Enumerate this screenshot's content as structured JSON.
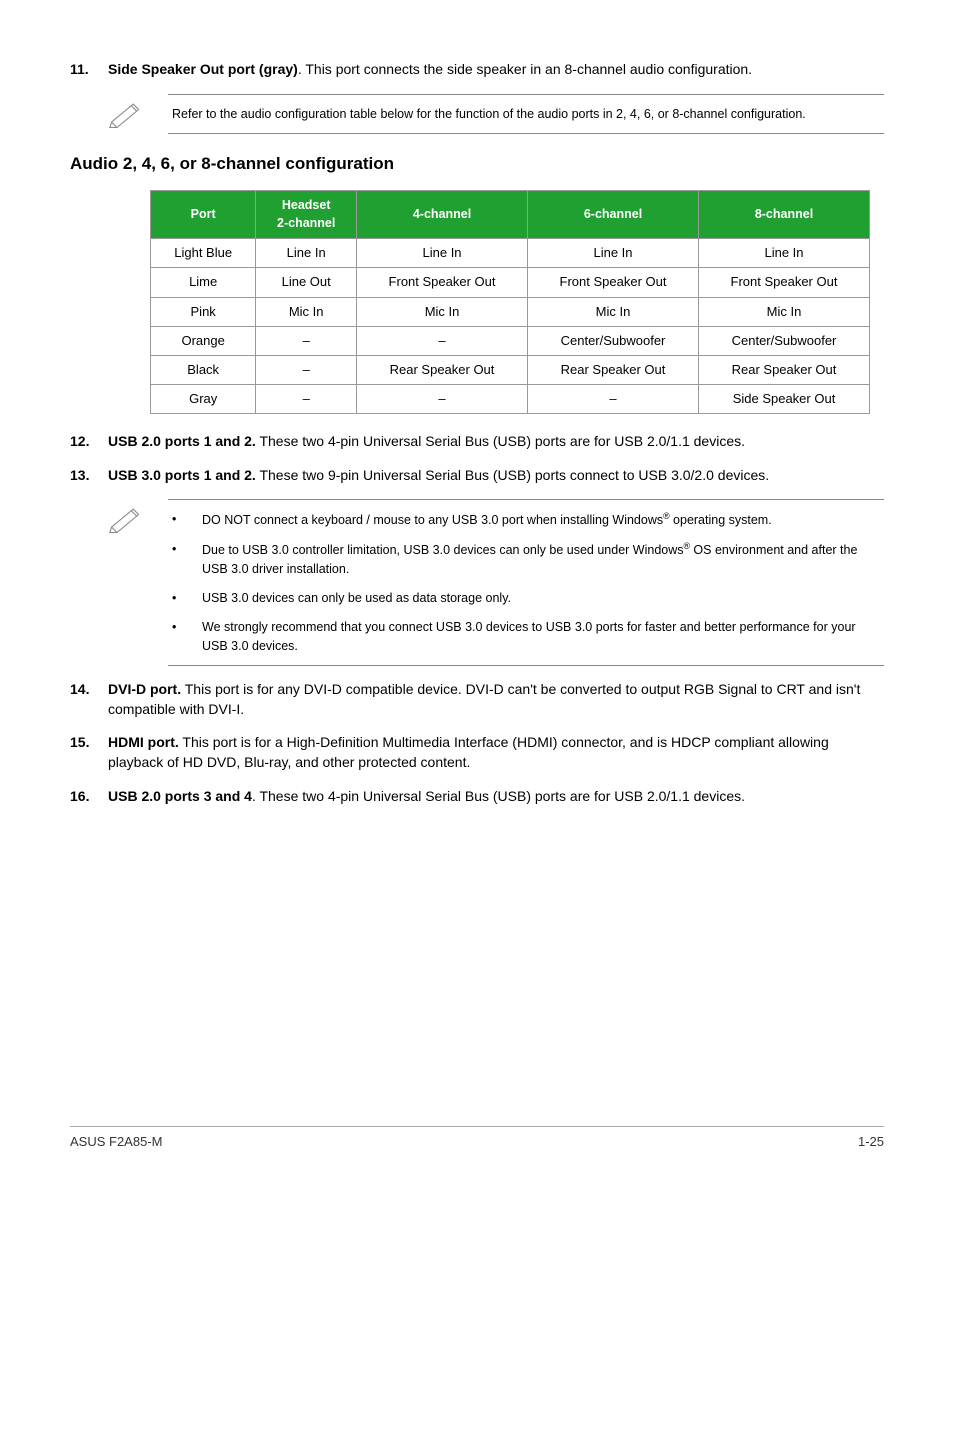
{
  "item11": {
    "num": "11.",
    "label": "Side Speaker Out port (gray)",
    "text": ". This port connects the side speaker in an 8-channel audio configuration."
  },
  "note1": "Refer to the audio configuration table below for the function of the audio ports in 2, 4, 6, or 8-channel configuration.",
  "section_title": "Audio 2, 4, 6, or 8-channel configuration",
  "table": {
    "headers": {
      "c0": "Port",
      "c1": "Headset\n2-channel",
      "c2": "4-channel",
      "c3": "6-channel",
      "c4": "8-channel"
    },
    "rows": [
      {
        "c0": "Light Blue",
        "c1": "Line In",
        "c2": "Line In",
        "c3": "Line In",
        "c4": "Line In"
      },
      {
        "c0": "Lime",
        "c1": "Line Out",
        "c2": "Front Speaker Out",
        "c3": "Front Speaker Out",
        "c4": "Front Speaker Out"
      },
      {
        "c0": "Pink",
        "c1": "Mic In",
        "c2": "Mic In",
        "c3": "Mic In",
        "c4": "Mic In"
      },
      {
        "c0": "Orange",
        "c1": "–",
        "c2": "–",
        "c3": "Center/Subwoofer",
        "c4": "Center/Subwoofer"
      },
      {
        "c0": "Black",
        "c1": "–",
        "c2": "Rear Speaker Out",
        "c3": "Rear Speaker Out",
        "c4": "Rear Speaker Out"
      },
      {
        "c0": "Gray",
        "c1": "–",
        "c2": "–",
        "c3": "–",
        "c4": "Side Speaker Out"
      }
    ]
  },
  "item12": {
    "num": "12.",
    "label": "USB 2.0 ports 1 and 2.",
    "text": " These two 4-pin Universal Serial Bus (USB) ports are for USB 2.0/1.1 devices."
  },
  "item13": {
    "num": "13.",
    "label": "USB 3.0 ports 1 and 2.",
    "text": " These two 9-pin Universal Serial Bus (USB) ports connect to USB 3.0/2.0 devices."
  },
  "note2": {
    "b1a": "DO NOT connect a keyboard / mouse to any USB 3.0 port when installing Windows",
    "b1b": " operating system.",
    "b2a": "Due to USB 3.0 controller limitation, USB 3.0 devices can only be used under Windows",
    "b2b": " OS environment and after the USB 3.0 driver installation.",
    "b3": "USB 3.0 devices can only be used as data storage only.",
    "b4": "We strongly recommend that you connect USB 3.0 devices to USB 3.0 ports for faster and better performance for your USB 3.0 devices."
  },
  "item14": {
    "num": "14.",
    "label": "DVI-D port.",
    "text": " This port is for any DVI-D compatible device. DVI-D can't be converted to output RGB Signal to CRT and isn't compatible with DVI-I."
  },
  "item15": {
    "num": "15.",
    "label": "HDMI port.",
    "text": " This port is for a High-Definition Multimedia Interface (HDMI) connector, and is HDCP compliant allowing playback of HD DVD, Blu-ray, and other protected content."
  },
  "item16": {
    "num": "16.",
    "label": "USB 2.0 ports 3 and 4",
    "text": ". These two 4-pin Universal Serial Bus (USB) ports are for USB 2.0/1.1 devices."
  },
  "footer": {
    "left": "ASUS F2A85-M",
    "right": "1-25"
  },
  "reg": "®"
}
